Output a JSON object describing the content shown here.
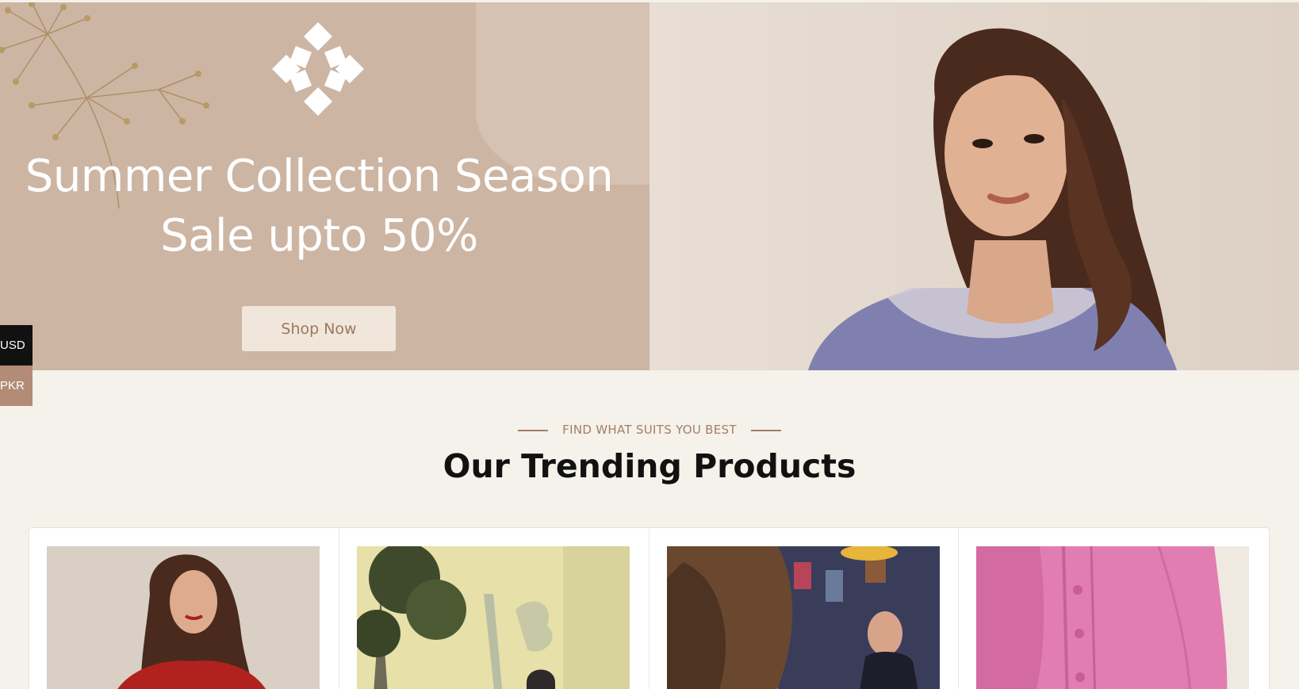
{
  "hero": {
    "title_line1": "Summer Collection Season",
    "title_line2": "Sale upto 50%",
    "cta_label": "Shop Now",
    "colors": {
      "left_bg": "#cdb5a3",
      "right_bg": "#e6dcd2",
      "cta_bg": "#f1e6dc",
      "cta_text": "#9a7960"
    }
  },
  "currency_switcher": {
    "options": [
      "USD",
      "PKR"
    ],
    "selected": "USD",
    "colors": {
      "active": "#111111",
      "inactive": "#b28c76"
    }
  },
  "section": {
    "eyebrow": "FIND WHAT SUITS YOU BEST",
    "title": "Our Trending Products"
  },
  "products": [
    {
      "image": "model-red-dress"
    },
    {
      "image": "model-garden-shadow"
    },
    {
      "image": "model-hair-salon"
    },
    {
      "image": "pink-shirt-detail"
    }
  ],
  "icons": {
    "logo": "brand-snowflake-logo"
  }
}
